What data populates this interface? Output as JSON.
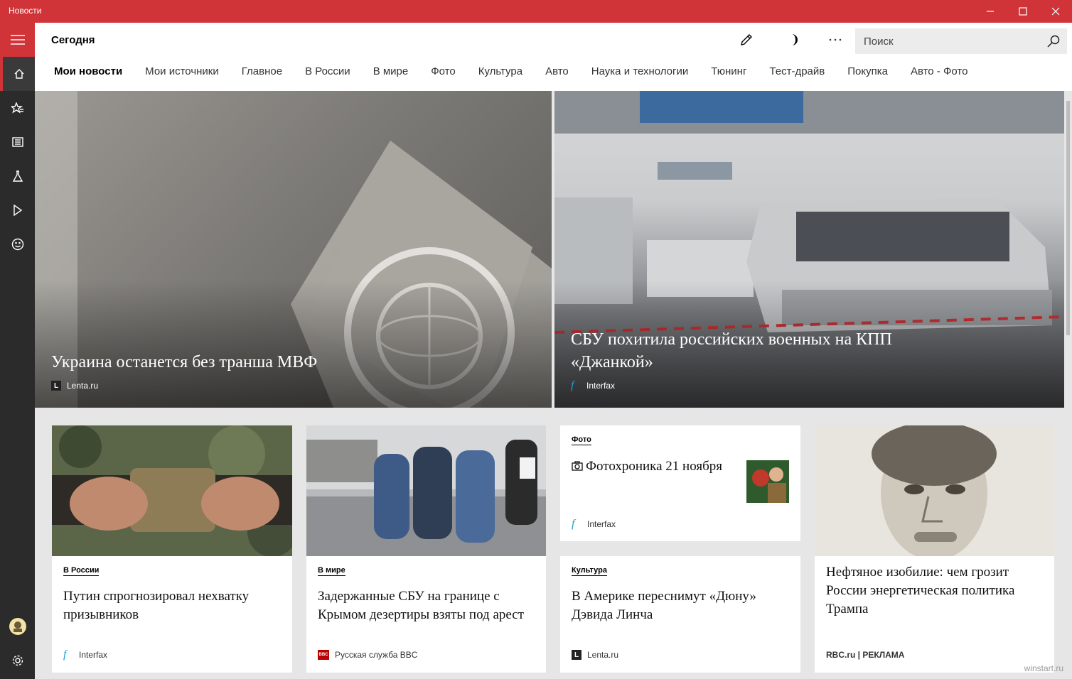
{
  "window": {
    "title": "Новости"
  },
  "header": {
    "page_title": "Сегодня",
    "search_placeholder": "Поиск"
  },
  "tabs": [
    {
      "label": "Мои новости",
      "active": true
    },
    {
      "label": "Мои источники"
    },
    {
      "label": "Главное"
    },
    {
      "label": "В России"
    },
    {
      "label": "В мире"
    },
    {
      "label": "Фото"
    },
    {
      "label": "Культура"
    },
    {
      "label": "Авто"
    },
    {
      "label": "Наука и технологии"
    },
    {
      "label": "Тюнинг"
    },
    {
      "label": "Тест-драйв"
    },
    {
      "label": "Покупка"
    },
    {
      "label": "Авто - Фото"
    }
  ],
  "rail": {
    "items": [
      "home-icon",
      "favorites-icon",
      "news-icon",
      "science-icon",
      "video-icon",
      "smiley-icon"
    ],
    "bottom": [
      "avatar",
      "gear-icon"
    ]
  },
  "hero": [
    {
      "headline": "Украина останется без транша МВФ",
      "source": "Lenta.ru"
    },
    {
      "headline": "СБУ похитила российских военных на КПП «Джанкой»",
      "source": "Interfax"
    }
  ],
  "cards": [
    {
      "category": "В России",
      "title": "Путин спрогнозировал нехватку призывников",
      "source": "Interfax"
    },
    {
      "category": "В мире",
      "title": "Задержанные СБУ на границе с Крымом дезертиры взяты под арест",
      "source": "Русская служба BBC"
    },
    {
      "category": "Фото",
      "title": "Фотохроника 21 ноября",
      "source": "Interfax"
    },
    {
      "category": "Культура",
      "title": "В Америке переснимут «Дюну» Дэвида Линча",
      "source": "Lenta.ru"
    },
    {
      "title": "Нефтяное изобилие: чем грозит России энергетическая политика Трампа",
      "source": "RBC.ru | РЕКЛАМА"
    }
  ],
  "watermark": "winstart.ru",
  "colors": {
    "accent": "#d13438",
    "rail": "#2b2b2b",
    "background": "#e6e6e6"
  }
}
